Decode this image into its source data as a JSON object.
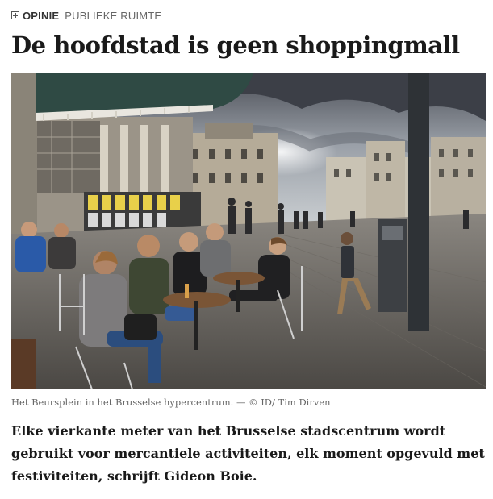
{
  "article": {
    "section": "OPINIE",
    "subsection": "PUBLIEKE RUIMTE",
    "section_icon": "plus-square-icon",
    "headline": "De hoofdstad is geen shoppingmall",
    "photo": {
      "caption": "Het Beursplein in het Brusselse hypercentrum. — © ID/ Tim Dirven"
    },
    "lead": "Elke vierkante meter van het Brusselse stadscentrum wordt gebruikt voor mercantiele activiteiten, elk moment opgevuld met festiviteiten, schrijft Gideon Boie."
  },
  "colors": {
    "text": "#1a1a1a",
    "muted": "#666666",
    "awning": "#2f4a44"
  }
}
